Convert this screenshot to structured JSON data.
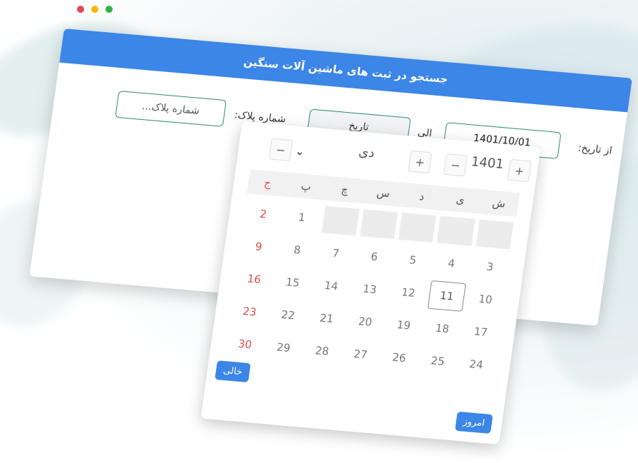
{
  "window": {
    "traffic_lights": [
      "red",
      "yellow",
      "green"
    ]
  },
  "header": {
    "title": "جستجو در ثبت های ماشین آلات سنگین"
  },
  "form": {
    "from_date_label": "از تاریخ:",
    "from_date_value": "1401/10/01",
    "to_label": "الی",
    "to_date_value": "تاریخ",
    "plate_label": "شماره پلاک:",
    "plate_placeholder": "شماره پلاک..."
  },
  "calendar": {
    "year": "1401",
    "month": "دی",
    "plus": "+",
    "minus": "−",
    "weekdays": [
      "ش",
      "ی",
      "د",
      "س",
      "چ",
      "پ",
      "ج"
    ],
    "weeks": [
      [
        "",
        "",
        "",
        "",
        "",
        "1",
        "2"
      ],
      [
        "3",
        "4",
        "5",
        "6",
        "7",
        "8",
        "9"
      ],
      [
        "10",
        "11",
        "12",
        "13",
        "14",
        "15",
        "16"
      ],
      [
        "17",
        "18",
        "19",
        "20",
        "21",
        "22",
        "23"
      ],
      [
        "24",
        "25",
        "26",
        "27",
        "28",
        "29",
        "30"
      ]
    ],
    "selected_day": "11",
    "clear_label": "خالی",
    "today_label": "امروز"
  },
  "colors": {
    "accent": "#3b86e6",
    "border": "#2a8c6e",
    "friday": "#e24c4c"
  }
}
